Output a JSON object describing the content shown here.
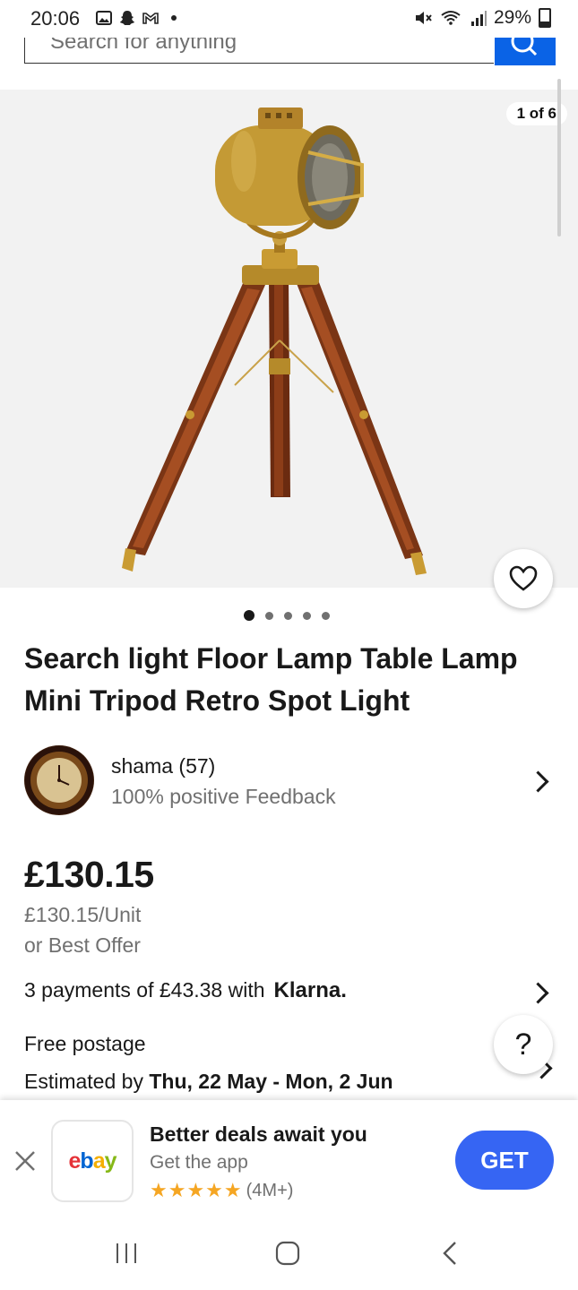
{
  "status_bar": {
    "time": "20:06",
    "battery": "29%",
    "icons": [
      "gallery-icon",
      "snapchat-icon",
      "gmail-icon",
      "notification-dot-icon",
      "mute-icon",
      "wifi-icon",
      "signal-icon",
      "battery-icon"
    ]
  },
  "search": {
    "placeholder": "Search for anything"
  },
  "gallery": {
    "counter": "1 of 6",
    "dots_total": 5,
    "active_dot": 1
  },
  "listing": {
    "title": "Search light Floor Lamp Table Lamp Mini Tripod Retro Spot Light"
  },
  "seller": {
    "name": "shama (57)",
    "feedback": "100% positive Feedback"
  },
  "pricing": {
    "price": "£130.15",
    "unit_price": "£130.15/Unit",
    "best_offer": "or Best Offer",
    "installments": "3 payments of £43.38 with",
    "klarna": "Klarna."
  },
  "shipping": {
    "postage": "Free postage",
    "estimated_prefix": "Estimated by",
    "estimated_dates": "Thu, 22 May - Mon, 2 Jun"
  },
  "help": {
    "label": "?"
  },
  "app_banner": {
    "title": "Better deals await you",
    "subtitle": "Get the app",
    "rating_count": "(4M+)",
    "stars": "★★★★★",
    "get_label": "GET",
    "logo_letters": [
      "e",
      "b",
      "a",
      "y"
    ]
  },
  "colors": {
    "ebay_blue": "#3665f3",
    "search_blue": "#0a63e6",
    "logo_e": "#e53238",
    "logo_b": "#0064d2",
    "logo_a": "#f5af02",
    "logo_y": "#86b817"
  }
}
